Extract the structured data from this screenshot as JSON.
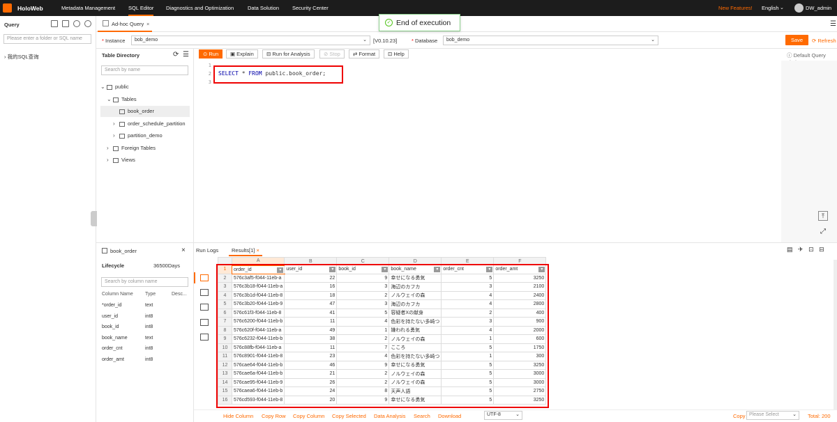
{
  "app": {
    "brand": "HoloWeb"
  },
  "nav": [
    "Metadata Management",
    "SQL Editor",
    "Diagnostics and Optimization",
    "Data Solution",
    "Security Center"
  ],
  "header_right": {
    "new_features": "New Features!",
    "language": "English",
    "user": "DW_admin"
  },
  "toast": {
    "text": "End of execution"
  },
  "left": {
    "title": "Query",
    "search_placeholder": "Please enter a folder or SQL name",
    "item": "我的SQL查询"
  },
  "tabs": {
    "active": "Ad-hoc Query"
  },
  "instance": {
    "label": "Instance",
    "value": "bob_demo",
    "version": "[V0.10.23]",
    "db_label": "Database",
    "db_value": "bob_demo"
  },
  "actions": {
    "save": "Save",
    "refresh": "Refresh"
  },
  "table_directory": {
    "title": "Table Directory",
    "search_placeholder": "Search by name",
    "schema": "public",
    "tables_label": "Tables",
    "tables": [
      "book_order",
      "order_schedule_partition",
      "partition_demo"
    ],
    "foreign": "Foreign Tables",
    "views": "Views"
  },
  "toolbar": {
    "run": "Run",
    "explain": "Explain",
    "run_analysis": "Run for Analysis",
    "stop": "Stop",
    "format": "Format",
    "help": "Help",
    "limit": "Default Query Limit"
  },
  "editor": {
    "lines": [
      "1",
      "2",
      "3"
    ],
    "sql_kw1": "SELECT",
    "sql_star": " * ",
    "sql_kw2": "FROM",
    "sql_rest": " public.book_order;"
  },
  "info": {
    "table": "book_order",
    "lifecycle_label": "Lifecycle",
    "lifecycle_value": "36500Days",
    "search_placeholder": "Search by column name",
    "headers": [
      "Column Name",
      "Type",
      "Desc..."
    ],
    "columns": [
      {
        "name": "*order_id",
        "type": "text"
      },
      {
        "name": "user_id",
        "type": "int8"
      },
      {
        "name": "book_id",
        "type": "int8"
      },
      {
        "name": "book_name",
        "type": "text"
      },
      {
        "name": "order_cnt",
        "type": "int8"
      },
      {
        "name": "order_amt",
        "type": "int8"
      }
    ]
  },
  "results": {
    "tab_logs": "Run Logs",
    "tab_results": "Results[1]",
    "col_letters": [
      "A",
      "B",
      "C",
      "D",
      "E",
      "F"
    ],
    "headers": [
      "order_id",
      "user_id",
      "book_id",
      "book_name",
      "order_cnt",
      "order_amt"
    ],
    "rows": [
      [
        "576c3af5-f044-11eb-a",
        "22",
        "9",
        "幸せになる勇気",
        "5",
        "3250"
      ],
      [
        "576c3b18-f044-11eb-a",
        "16",
        "3",
        "海辺のカフカ",
        "3",
        "2100"
      ],
      [
        "576c3b1d-f044-11eb-8",
        "18",
        "2",
        "ノルウェイの森",
        "4",
        "2400"
      ],
      [
        "576c3b20-f044-11eb-9",
        "47",
        "3",
        "海辺のカフカ",
        "4",
        "2800"
      ],
      [
        "576c61f3-f044-11eb-8",
        "41",
        "5",
        "容疑者Xの献身",
        "2",
        "400"
      ],
      [
        "576c6200-f044-11eb-b",
        "11",
        "4",
        "色彩を持たない多崎つ",
        "3",
        "900"
      ],
      [
        "576c620f-f044-11eb-a",
        "49",
        "1",
        "嫌われる勇気",
        "4",
        "2000"
      ],
      [
        "576c6232-f044-11eb-b",
        "38",
        "2",
        "ノルウェイの森",
        "1",
        "600"
      ],
      [
        "576c88fb-f044-11eb-a",
        "11",
        "7",
        "こころ",
        "5",
        "1750"
      ],
      [
        "576c8901-f044-11eb-8",
        "23",
        "4",
        "色彩を持たない多崎つ",
        "1",
        "300"
      ],
      [
        "576cae64-f044-11eb-b",
        "46",
        "9",
        "幸せになる勇気",
        "5",
        "3250"
      ],
      [
        "576cae6a-f044-11eb-b",
        "21",
        "2",
        "ノルウェイの森",
        "5",
        "3000"
      ],
      [
        "576cae95-f044-11eb-9",
        "26",
        "2",
        "ノルウェイの森",
        "5",
        "3000"
      ],
      [
        "576caea6-f044-11eb-b",
        "24",
        "8",
        "天声人語",
        "5",
        "2750"
      ],
      [
        "576cd593-f044-11eb-8",
        "20",
        "9",
        "幸せになる勇気",
        "5",
        "3250"
      ]
    ]
  },
  "footer": {
    "links": [
      "Hide Column",
      "Copy Row",
      "Copy Column",
      "Copy Selected",
      "Data Analysis",
      "Search",
      "Download"
    ],
    "encoding": "UTF-8",
    "copy": "Copy",
    "copy_placeholder": "Please Select",
    "total": "Total: 200"
  },
  "colors": {
    "accent": "#ff6a00",
    "topbar": "#1c1c1c",
    "highlight": "#ee0000"
  }
}
